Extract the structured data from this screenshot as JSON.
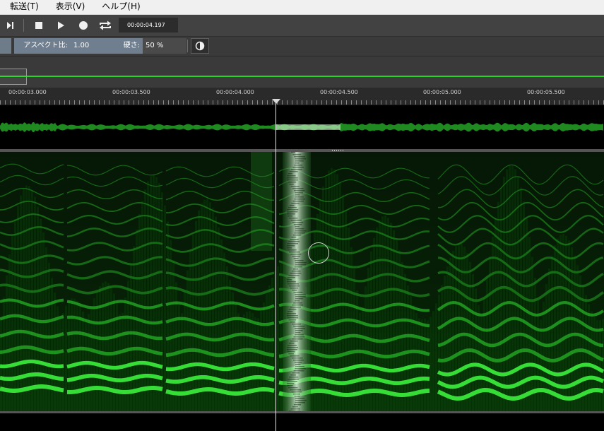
{
  "menu": {
    "items": [
      "転送(T)",
      "表示(V)",
      "ヘルプ(H)"
    ]
  },
  "transport": {
    "buttons": [
      "skip-to-end-icon",
      "stop-icon",
      "play-icon",
      "record-icon",
      "loop-icon"
    ],
    "time": "00:00:04.197"
  },
  "params": {
    "aspect_label": "アスペクト比:",
    "aspect_value": "1.00",
    "hardness_label": "硬さ:",
    "hardness_value": "50 %",
    "contrast_icon": "half-circle-icon"
  },
  "ruler": {
    "labels": [
      "00:00:03.000",
      "00:00:03.500",
      "00:00:04.000",
      "00:00:04.500",
      "00:00:05.000",
      "00:00:05.500"
    ]
  },
  "colors": {
    "waveform": "#1f8a1f",
    "spectrogram_accent": "#2bd62b",
    "overview_line": "#28d428",
    "selection_highlight": "#e0ffe0"
  }
}
